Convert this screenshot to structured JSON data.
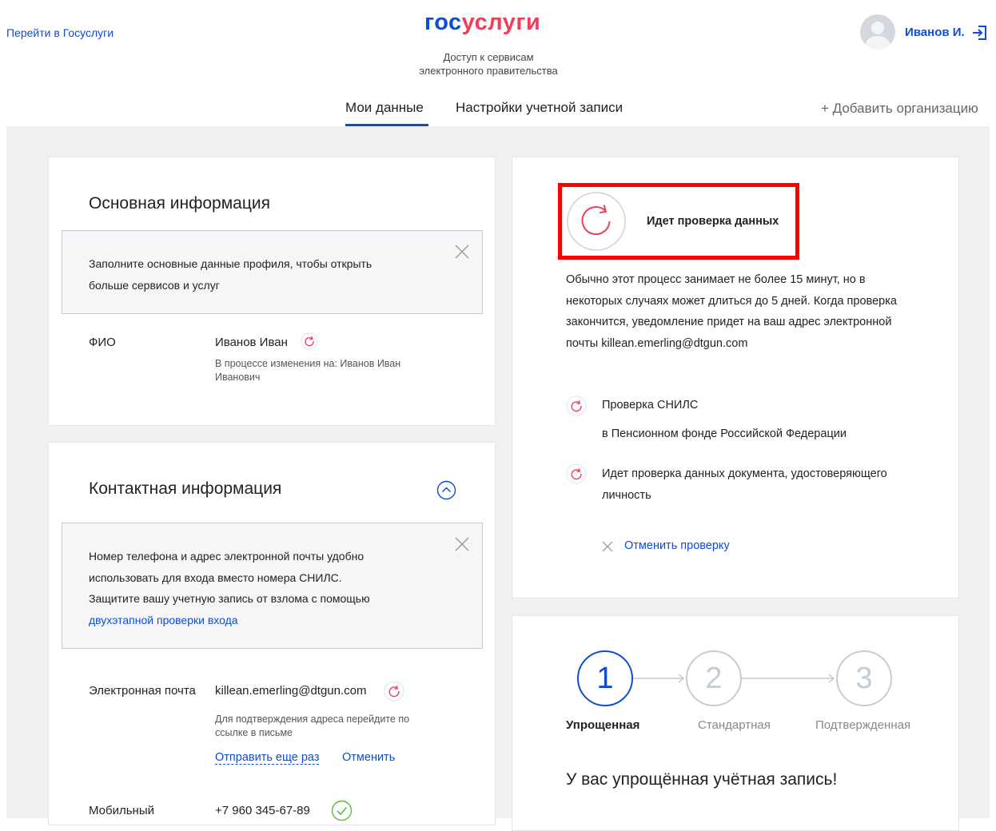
{
  "header": {
    "goto_link": "Перейти в Госуслуги",
    "logo_part1": "гос",
    "logo_part2": "услуги",
    "subtitle_line1": "Доступ к сервисам",
    "subtitle_line2": "электронного правительства",
    "username": "Иванов И."
  },
  "tabs": {
    "my_data": "Мои данные",
    "account_settings": "Настройки учетной записи",
    "add_org": "+ Добавить организацию"
  },
  "basic_info": {
    "title": "Основная информация",
    "notice_line1": "Заполните основные данные профиля, чтобы открыть",
    "notice_line2": "больше сервисов и услуг",
    "fio_label": "ФИО",
    "fio_value": "Иванов Иван",
    "fio_pending_line1": "В процессе изменения на: Иванов Иван",
    "fio_pending_line2": "Иванович"
  },
  "contact_info": {
    "title": "Контактная информация",
    "notice_line1": "Номер телефона и адрес электронной почты удобно",
    "notice_line2": "использовать для входа вместо номера СНИЛС.",
    "notice_line3": "Защитите вашу учетную запись от взлома с помощью",
    "notice_link": "двухэтапной проверки входа",
    "email_label": "Электронная почта",
    "email_value": "killean.emerling@dtgun.com",
    "email_hint_line1": "Для подтверждения адреса перейдите по",
    "email_hint_line2": "ссылке в письме",
    "resend": "Отправить еще раз",
    "cancel": "Отменить",
    "phone_label": "Мобильный",
    "phone_value": "+7 960 345-67-89"
  },
  "verification": {
    "title": "Идет проверка данных",
    "desc_line1": "Обычно этот процесс занимает не более 15 минут, но в",
    "desc_line2": "некоторых случаях может длиться до 5 дней. Когда проверка",
    "desc_line3": "закончится, уведомление придет на ваш адрес электронной",
    "desc_line4": "почты killean.emerling@dtgun.com",
    "check1_title": "Проверка СНИЛС",
    "check1_sub": "в Пенсионном фонде Российской Федерации",
    "check2_line1": "Идет проверка данных документа, удостоверяющего",
    "check2_line2": "личность",
    "cancel_check": "Отменить проверку"
  },
  "levels": {
    "steps": [
      {
        "num": "1",
        "label": "Упрощенная"
      },
      {
        "num": "2",
        "label": "Стандартная"
      },
      {
        "num": "3",
        "label": "Подтвержденная"
      }
    ],
    "current_step": 1,
    "result": "У вас упрощённая учётная запись!"
  },
  "colors": {
    "brand_blue": "#0d4cd3",
    "brand_red": "#ee3f58",
    "highlight_red": "#ff0000",
    "success_green": "#5fbb46"
  }
}
